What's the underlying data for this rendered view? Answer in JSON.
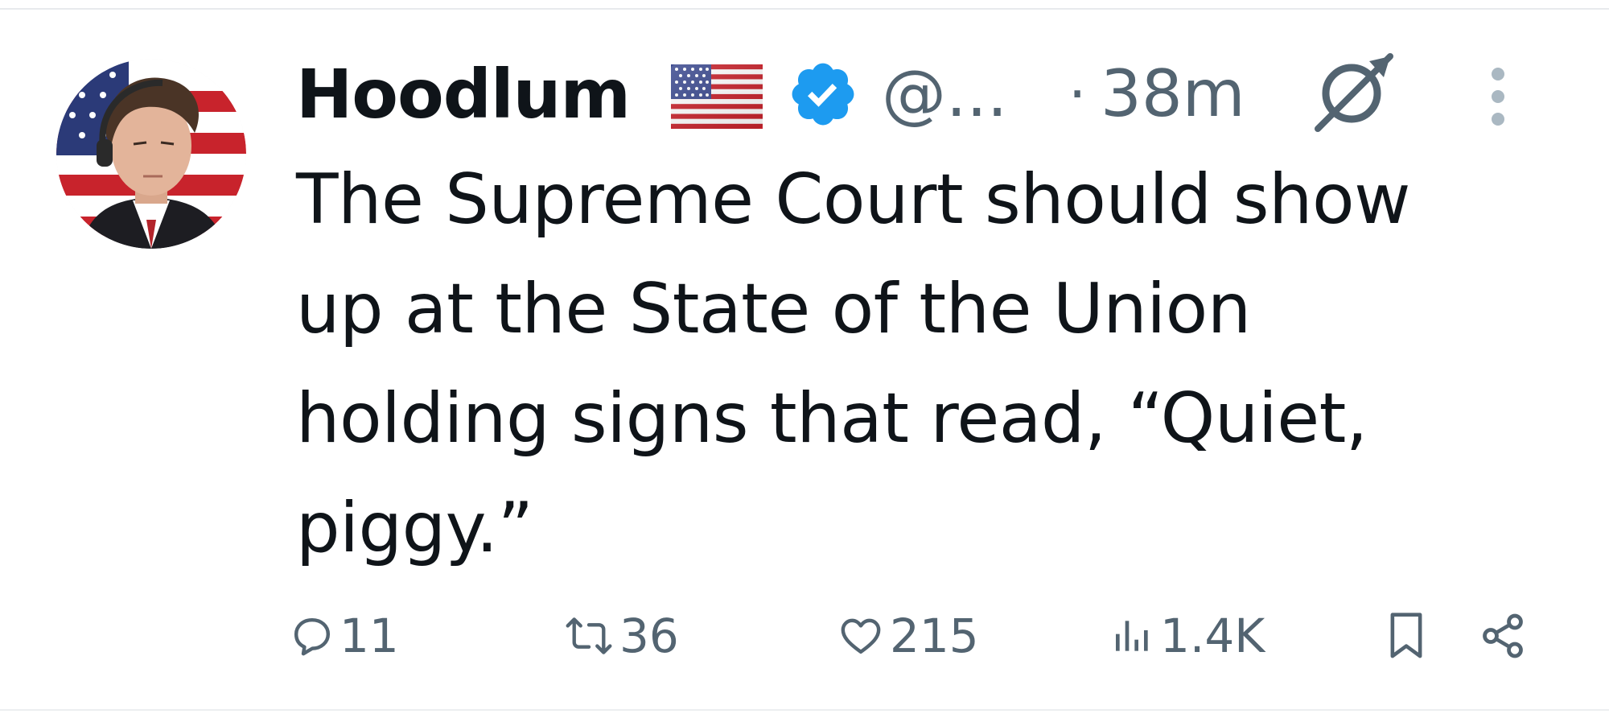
{
  "post": {
    "author": {
      "display_name": "Hoodlum",
      "handle": "@...",
      "flag_icon": "us-flag-icon",
      "verified_icon": "verified-badge-icon",
      "verified_color": "#1d9bf0"
    },
    "separator": "·",
    "timestamp": "38m",
    "text": "The Supreme Court should show\nup at the State of the Union\nholding signs that read, “Quiet,\npiggy.”",
    "actions": {
      "replies": "11",
      "reposts": "36",
      "likes": "215",
      "views": "1.4K"
    }
  },
  "colors": {
    "text_primary": "#0f1419",
    "text_secondary": "#536471",
    "more_icon": "#aab8c2"
  }
}
